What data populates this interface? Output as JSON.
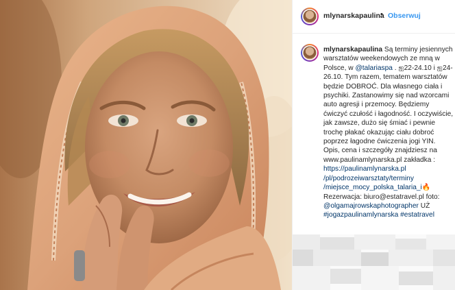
{
  "post": {
    "username": "mlynarskapaulina",
    "dot": "•",
    "follow_label": "Obserwuj"
  },
  "caption": {
    "username": "mlynarskapaulina",
    "text_1": " Są terminy jesiennych warsztatów weekendowych ze mną w Polsce, w ",
    "tag_1": "@talariaspa",
    "text_2": " . ஐ22-24.10 i ஐ24-26.10. Tym razem, tematem warsztatów będzie DOBROĆ. Dla własnego ciała i psychiki. Zastanowimy się nad wzorcami auto agresji i przemocy. Będziemy ćwiczyć czułość i łagodność. I oczywiście, jak zawsze, dużo się śmiać i pewnie trochę płakać okazując ciału dobroć poprzez łagodne ćwiczenia jogi YIN. Opis, cena i szczegóły znajdziesz na www.paulinamlynarska.pl zakładka : ",
    "link_1": "https://paulinamlynarska.pl /pl/podrozeiwarsztaty/terminy /miejsce_mocy_polska_talaria_i",
    "fire": "🔥",
    "text_3": " Rezerwacja: biuro@estatravel.pl foto: ",
    "tag_2": "@olgamajrowskaphotographer",
    "text_4": " UŻ ",
    "tag_3": "#jogazpaulinamlynarska #estatravel"
  },
  "colors": {
    "accent": "#3897f0",
    "text": "#262626",
    "tag": "#003569",
    "divider": "#efefef"
  },
  "icons": {
    "header_avatar": "profile-avatar",
    "caption_avatar": "profile-avatar"
  }
}
